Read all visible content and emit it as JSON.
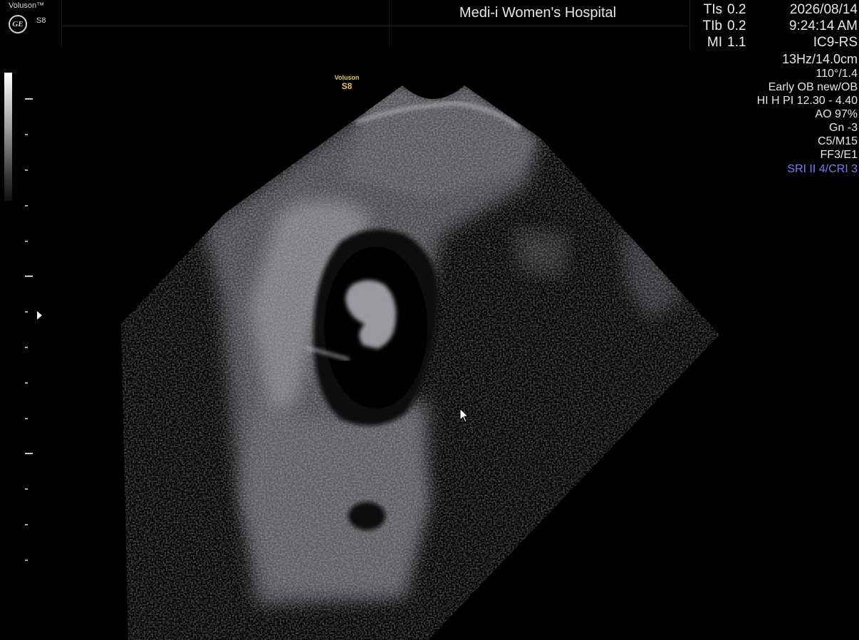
{
  "header": {
    "brand": "Voluson™",
    "model_small": "S8",
    "hospital": "Medi-i Women's Hospital",
    "logo_icon": "ge-logo-icon"
  },
  "indices": [
    {
      "label": "TIs",
      "value": "0.2"
    },
    {
      "label": "TIb",
      "value": "0.2"
    },
    {
      "label": "MI",
      "value": "1.1"
    }
  ],
  "right_panel": {
    "date": "2026/08/14",
    "time": "9:24:14 AM",
    "probe": "IC9-RS",
    "freq_depth": "13Hz/14.0cm",
    "angle": "110°/1.4",
    "preset": "Early OB new/OB",
    "hi_pi": "HI H PI 12.30 - 4.40",
    "ao": "AO 97%",
    "gain": "Gn  -3",
    "c_m": "C5/M15",
    "ff_e": "FF3/E1",
    "sri_cri": "SRI II 4/CRI 3",
    "sri_color": "#7a7aff"
  },
  "probe_label": {
    "line1": "Voluson",
    "line2": "S8",
    "color": "#e8c74d"
  },
  "colors": {
    "background": "#000000",
    "text": "#e6e6e6"
  }
}
